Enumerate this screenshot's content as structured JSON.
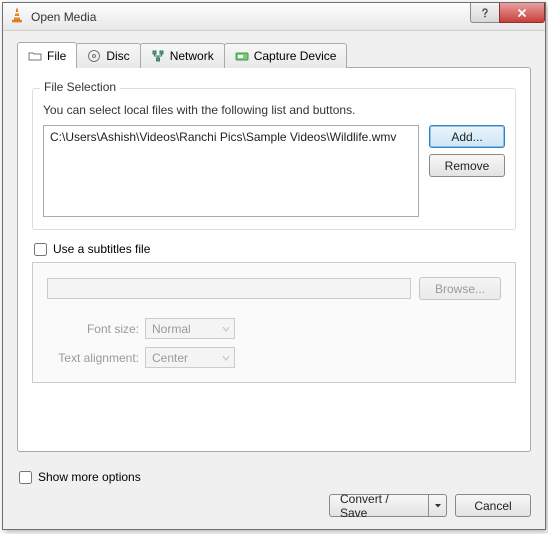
{
  "window": {
    "title": "Open Media"
  },
  "tabs": {
    "file": "File",
    "disc": "Disc",
    "network": "Network",
    "capture": "Capture Device"
  },
  "file_selection": {
    "heading": "File Selection",
    "description": "You can select local files with the following list and buttons.",
    "items": [
      "C:\\Users\\Ashish\\Videos\\Ranchi Pics\\Sample Videos\\Wildlife.wmv"
    ],
    "add_label": "Add...",
    "remove_label": "Remove"
  },
  "subtitles": {
    "checkbox_label": "Use a subtitles file",
    "browse_label": "Browse...",
    "font_size_label": "Font size:",
    "font_size_value": "Normal",
    "alignment_label": "Text alignment:",
    "alignment_value": "Center"
  },
  "more_options_label": "Show more options",
  "actions": {
    "convert_label": "Convert / Save",
    "cancel_label": "Cancel"
  }
}
